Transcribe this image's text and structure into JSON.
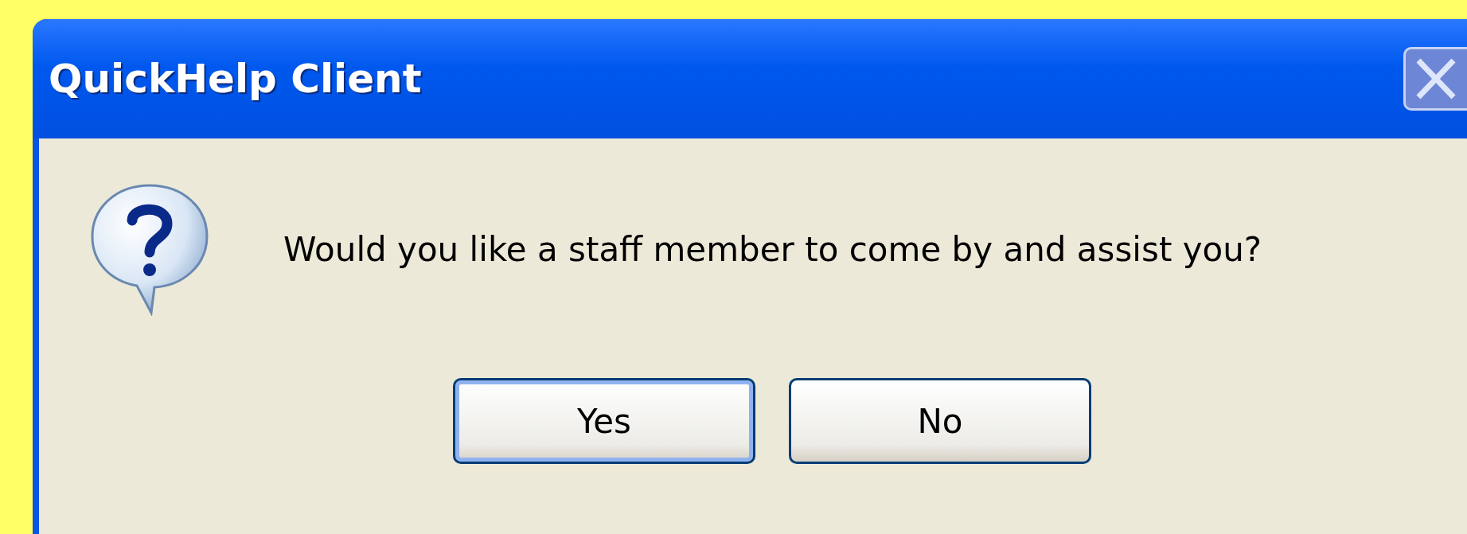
{
  "window": {
    "title": "QuickHelp Client"
  },
  "message": "Would you like a staff member to come by and assist you?",
  "buttons": [
    {
      "label": "Yes",
      "default": true
    },
    {
      "label": "No",
      "default": false
    }
  ]
}
